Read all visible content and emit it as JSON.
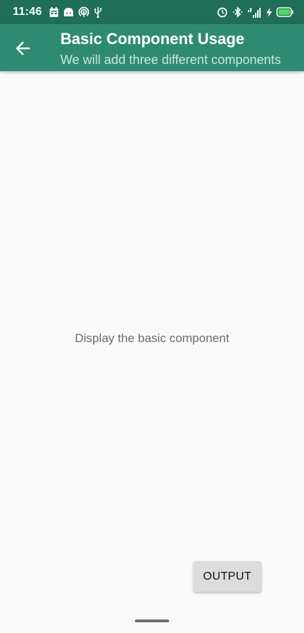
{
  "status_bar": {
    "time": "11:46",
    "left_icons": [
      "calendar-icon",
      "android-icon",
      "hotspot-icon",
      "usb-icon"
    ],
    "right_icons": [
      "alarm-icon",
      "bluetooth-icon",
      "signal-icon",
      "charging-icon",
      "battery-icon"
    ]
  },
  "app_bar": {
    "title": "Basic Component Usage",
    "subtitle": "We will add three different components",
    "back_icon": "arrow-left-icon"
  },
  "main": {
    "message": "Display the basic component"
  },
  "actions": {
    "output_label": "OUTPUT"
  },
  "colors": {
    "status_bar": "#1f6e57",
    "app_bar": "#2e8b72",
    "subtitle": "#c9e7dd",
    "background": "#fafafa",
    "button": "#dcdcdc",
    "battery_fill": "#4cd964"
  }
}
